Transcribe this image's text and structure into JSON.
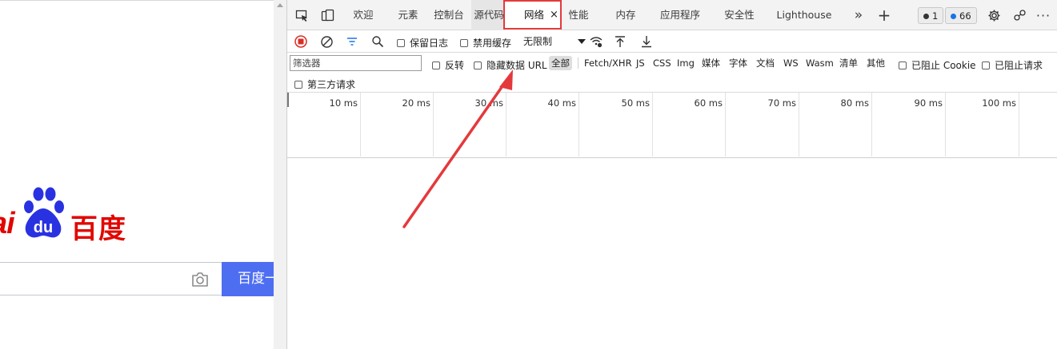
{
  "page": {
    "logo_left": "ai",
    "logo_mid": "du",
    "logo_cn": "百度",
    "search_button": "百度一下",
    "logo_color": "#e10601",
    "button_color": "#4e6ef2"
  },
  "devtools": {
    "tabs": [
      {
        "label": "欢迎"
      },
      {
        "label": "元素"
      },
      {
        "label": "控制台"
      },
      {
        "label": "源代码"
      },
      {
        "label": "网络"
      },
      {
        "label": "性能"
      },
      {
        "label": "内存"
      },
      {
        "label": "应用程序"
      },
      {
        "label": "安全性"
      },
      {
        "label": "Lighthouse"
      }
    ],
    "tab_close": "×",
    "more_tabs": "»",
    "add_tab": "+",
    "error_count": "1",
    "issue_count": "66",
    "settings_icon": "gear-icon",
    "highlight_color": "#e4393c"
  },
  "network_toolbar": {
    "preserve_log": "保留日志",
    "disable_cache": "禁用缓存",
    "throttle": "无限制"
  },
  "filter": {
    "placeholder": "筛选器",
    "invert": "反转",
    "hide_data_urls": "隐藏数据 URL",
    "types": [
      "全部",
      "Fetch/XHR",
      "JS",
      "CSS",
      "Img",
      "媒体",
      "字体",
      "文档",
      "WS",
      "Wasm",
      "清单",
      "其他"
    ],
    "blocked_cookies": "已阻止 Cookie",
    "blocked_requests": "已阻止请求",
    "third_party": "第三方请求"
  },
  "timeline": {
    "ticks": [
      "10 ms",
      "20 ms",
      "30 ms",
      "40 ms",
      "50 ms",
      "60 ms",
      "70 ms",
      "80 ms",
      "90 ms",
      "100 ms"
    ]
  }
}
